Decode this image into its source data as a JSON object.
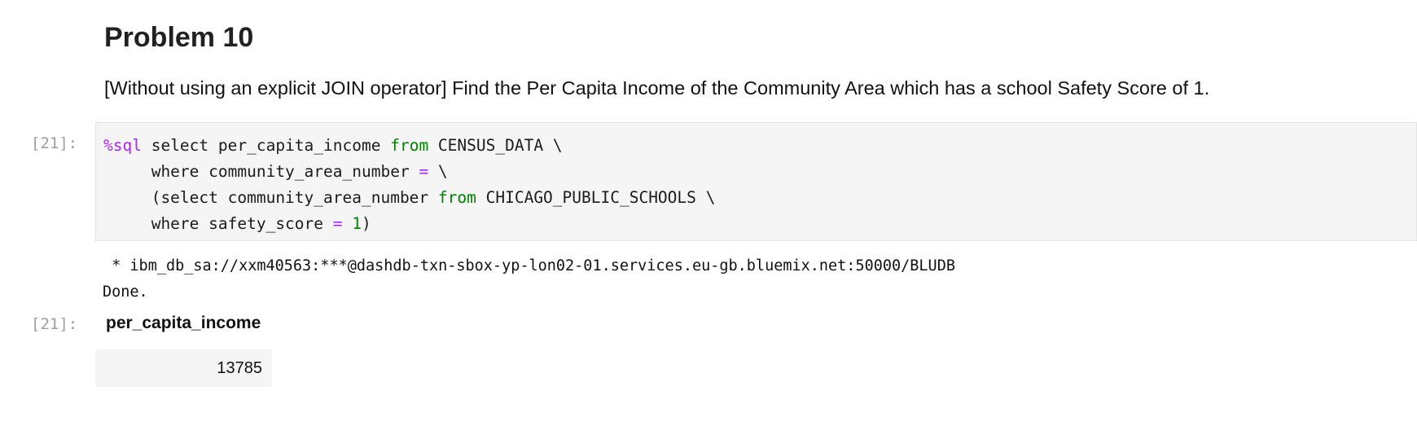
{
  "heading": "Problem 10",
  "problem_text": "[Without using an explicit JOIN operator] Find the Per Capita Income of the Community Area which has a school Safety Score of 1.",
  "input_prompt": "[21]:",
  "output_prompt": "[21]:",
  "code": {
    "line1": {
      "magic": "%sql",
      "a": " select per_capita_income ",
      "kw": "from",
      "b": " CENSUS_DATA \\"
    },
    "line2": {
      "a": "     where community_area_number ",
      "op": "=",
      "b": " \\"
    },
    "line3": {
      "a": "     (select community_area_number ",
      "kw": "from",
      "b": " CHICAGO_PUBLIC_SCHOOLS \\"
    },
    "line4": {
      "a": "     where safety_score ",
      "op": "=",
      "num": "1",
      "b": ")"
    }
  },
  "stdout": {
    "connection": " * ibm_db_sa://xxm40563:***@dashdb-txn-sbox-yp-lon02-01.services.eu-gb.bluemix.net:50000/BLUDB",
    "status": "Done."
  },
  "result": {
    "column_header": "per_capita_income",
    "value": "13785"
  }
}
